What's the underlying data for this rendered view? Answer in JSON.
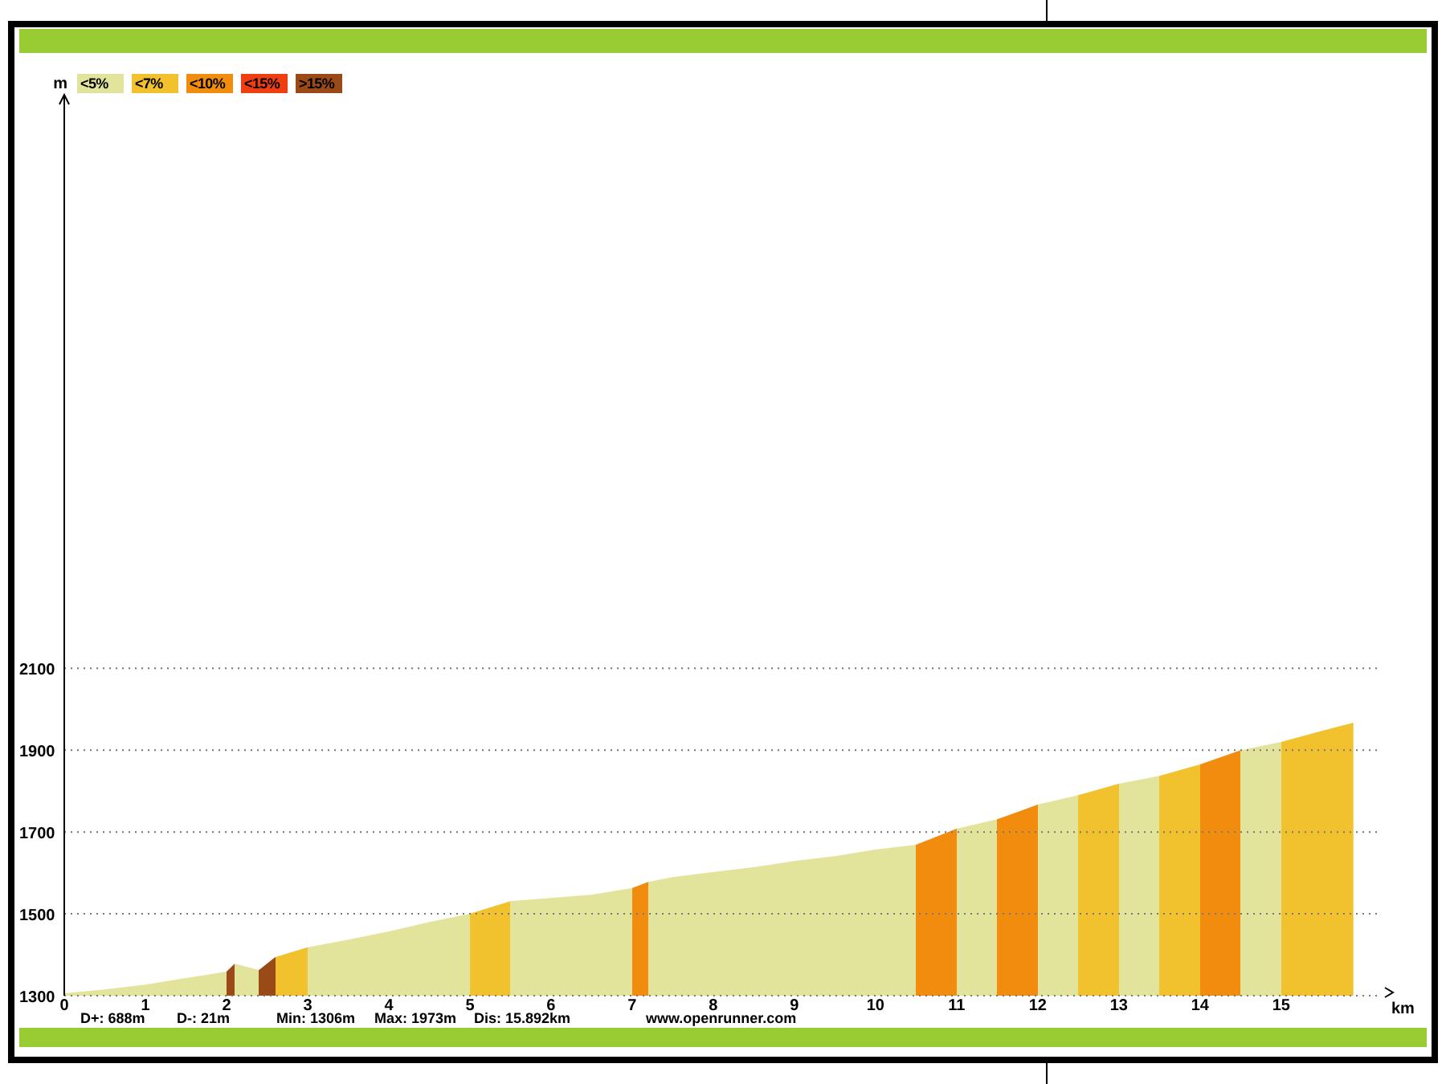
{
  "legend": {
    "items": [
      {
        "label": "<5%",
        "color": "#e3e49c"
      },
      {
        "label": "<7%",
        "color": "#f2c12e"
      },
      {
        "label": "<10%",
        "color": "#f28c0f"
      },
      {
        "label": "<15%",
        "color": "#ef3e12"
      },
      {
        "label": ">15%",
        "color": "#9a4a16"
      }
    ]
  },
  "chart_data": {
    "type": "area",
    "grid": true,
    "xlabel": "km",
    "ylabel": "m",
    "xlim": [
      0,
      16.2
    ],
    "ylim": [
      1300,
      3490
    ],
    "xticks": [
      0,
      1,
      2,
      3,
      4,
      5,
      6,
      7,
      8,
      9,
      10,
      11,
      12,
      13,
      14,
      15
    ],
    "yticks": [
      1300,
      1500,
      1700,
      1900,
      2100
    ],
    "x": [
      0,
      0.5,
      1,
      1.5,
      2,
      2.1,
      2.4,
      2.6,
      3,
      3.5,
      4,
      4.5,
      5,
      5.5,
      6,
      6.5,
      7,
      7.2,
      7.5,
      8,
      8.5,
      9,
      9.5,
      10,
      10.5,
      11,
      11.5,
      12,
      12.5,
      13,
      13.5,
      14,
      14.5,
      15,
      15.5,
      15.89
    ],
    "series": [
      {
        "values": [
          1306,
          1315,
          1327,
          1343,
          1359,
          1378,
          1363,
          1394,
          1418,
          1437,
          1457,
          1480,
          1500,
          1531,
          1539,
          1547,
          1563,
          1578,
          1590,
          1602,
          1614,
          1629,
          1641,
          1657,
          1669,
          1708,
          1731,
          1767,
          1790,
          1818,
          1837,
          1865,
          1900,
          1920,
          1947,
          1967
        ]
      }
    ]
  },
  "stats": [
    "D+: 688m",
    "D-: 21m",
    "Min: 1306m",
    "Max: 1973m",
    "Dis: 15.892km",
    "www.openrunner.com"
  ]
}
